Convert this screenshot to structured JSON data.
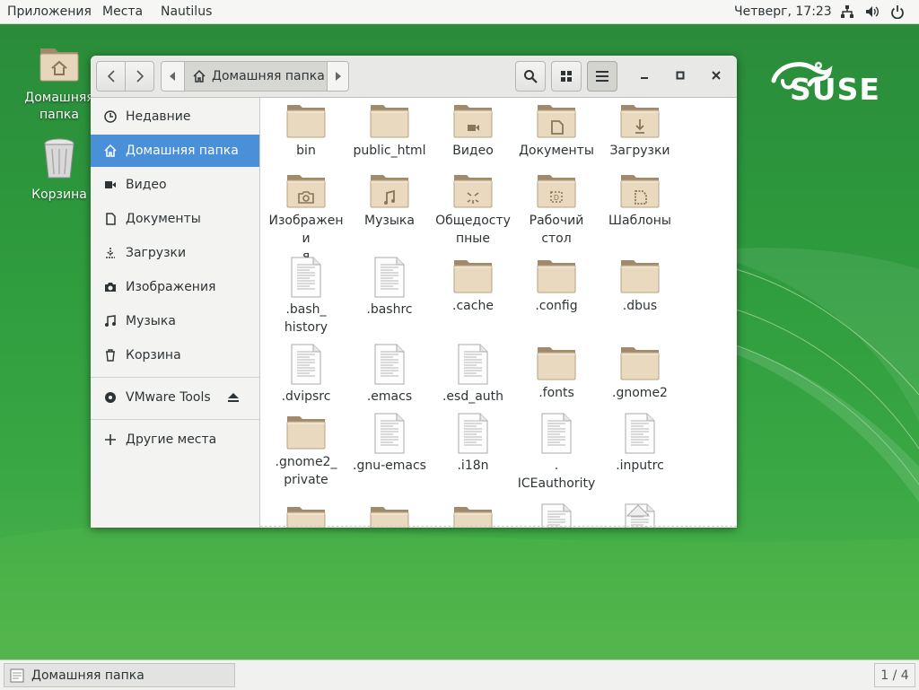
{
  "topbar": {
    "apps": "Приложения",
    "places": "Места",
    "app_name": "Nautilus",
    "clock": "Четверг, 17:23",
    "tray": [
      "network-icon",
      "volume-icon",
      "power-icon"
    ]
  },
  "desktop": {
    "home_label_1": "Домашняя",
    "home_label_2": "папка",
    "trash_label": "Корзина",
    "brand": "SUSE",
    "colors": {
      "desktop": "#2d9a3d",
      "brand": "#ffffff"
    }
  },
  "window": {
    "path_current": "Домашняя папка",
    "sidebar": [
      {
        "label": "Недавние",
        "icon": "clock-icon"
      },
      {
        "label": "Домашняя папка",
        "icon": "home-icon",
        "selected": true
      },
      {
        "label": "Видео",
        "icon": "video-icon"
      },
      {
        "label": "Документы",
        "icon": "document-icon"
      },
      {
        "label": "Загрузки",
        "icon": "download-icon"
      },
      {
        "label": "Изображения",
        "icon": "camera-icon"
      },
      {
        "label": "Музыка",
        "icon": "music-icon"
      },
      {
        "label": "Корзина",
        "icon": "trash-icon"
      }
    ],
    "vmware": "VMware Tools",
    "other": "Другие места",
    "selection_color": "#4a90d9",
    "files": [
      [
        "bin",
        "",
        "folder"
      ],
      [
        "public_html",
        "",
        "folder"
      ],
      [
        "Видео",
        "",
        "folder-video"
      ],
      [
        "Документы",
        "",
        "folder-docs"
      ],
      [
        "Загрузки",
        "",
        "folder-download"
      ],
      [
        "Изображени",
        "я",
        "folder-pictures"
      ],
      [
        "Музыка",
        "",
        "folder-music"
      ],
      [
        "Общедосту",
        "пные",
        "folder-public"
      ],
      [
        "Рабочий",
        "стол",
        "folder-desktop"
      ],
      [
        "Шаблоны",
        "",
        "folder-templates"
      ],
      [
        ".bash_",
        "history",
        "file"
      ],
      [
        ".bashrc",
        "",
        "file"
      ],
      [
        ".cache",
        "",
        "folder"
      ],
      [
        ".config",
        "",
        "folder"
      ],
      [
        ".dbus",
        "",
        "folder"
      ],
      [
        ".dvipsrc",
        "",
        "file"
      ],
      [
        ".emacs",
        "",
        "file"
      ],
      [
        ".esd_auth",
        "",
        "file"
      ],
      [
        ".fonts",
        "",
        "folder"
      ],
      [
        ".gnome2",
        "",
        "folder"
      ],
      [
        ".gnome2_",
        "private",
        "folder"
      ],
      [
        ".gnu-emacs",
        "",
        "file"
      ],
      [
        ".i18n",
        "",
        "file"
      ],
      [
        ".",
        "ICEauthority",
        "file"
      ],
      [
        ".inputrc",
        "",
        "file"
      ],
      [
        "",
        "",
        "folder"
      ],
      [
        "",
        "",
        "folder"
      ],
      [
        "",
        "",
        "folder"
      ],
      [
        "",
        "",
        "file"
      ],
      [
        "",
        "",
        "file-special"
      ]
    ]
  },
  "taskbar": {
    "task_label": "Домашняя папка",
    "workspace": "1 / 4"
  }
}
